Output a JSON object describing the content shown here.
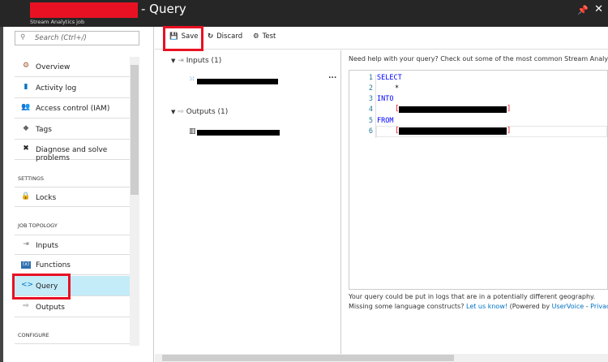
{
  "header": {
    "title": "- Query",
    "subtitle": "Stream Analytics job"
  },
  "search": {
    "placeholder": "Search (Ctrl+/)"
  },
  "sidebar": {
    "items": [
      {
        "label": "Overview",
        "icon": "overview-icon"
      },
      {
        "label": "Activity log",
        "icon": "activity-log-icon"
      },
      {
        "label": "Access control (IAM)",
        "icon": "iam-icon"
      },
      {
        "label": "Tags",
        "icon": "tag-icon"
      },
      {
        "label": "Diagnose and solve problems",
        "icon": "wrench-icon"
      }
    ],
    "settings_header": "SETTINGS",
    "settings": [
      {
        "label": "Locks",
        "icon": "lock-icon"
      }
    ],
    "topology_header": "JOB TOPOLOGY",
    "topology": [
      {
        "label": "Inputs",
        "icon": "inputs-icon"
      },
      {
        "label": "Functions",
        "icon": "functions-icon"
      },
      {
        "label": "Query",
        "icon": "code-icon",
        "selected": true
      },
      {
        "label": "Outputs",
        "icon": "outputs-icon"
      }
    ],
    "configure_header": "CONFIGURE"
  },
  "toolbar": {
    "save": "Save",
    "discard": "Discard",
    "test": "Test"
  },
  "tree": {
    "inputs": "Inputs (1)",
    "outputs": "Outputs (1)",
    "more": "..."
  },
  "editor": {
    "help": "Need help with your query? Check out some of the most common Stream Analytics q",
    "lines": [
      "SELECT",
      "*",
      "INTO",
      "[",
      "FROM",
      "["
    ],
    "line_numbers": [
      "1",
      "2",
      "3",
      "4",
      "5",
      "6"
    ]
  },
  "notes": {
    "geo": "Your query could be put in logs that are in a potentially different geography.",
    "missing": "Missing some language constructs?",
    "let_us_know": "Let us know!",
    "powered": "(Powered by",
    "uservoice": "UserVoice",
    "dash": "-",
    "privacy": "Privacy Pol"
  },
  "colors": {
    "accent": "#0072c6",
    "selected": "#c3ecf8",
    "highlight": "#e81123",
    "keyword": "#0000ff"
  }
}
